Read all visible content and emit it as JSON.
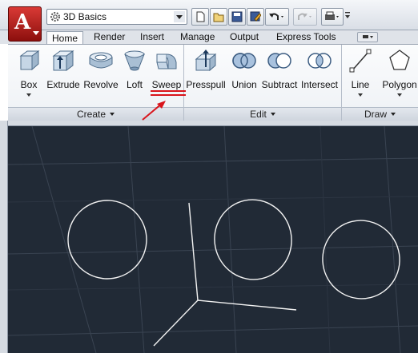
{
  "app": {
    "logo_letter": "A",
    "workspace": {
      "value": "3D Basics"
    }
  },
  "tabs": [
    {
      "label": "Home",
      "active": true
    },
    {
      "label": "Render"
    },
    {
      "label": "Insert"
    },
    {
      "label": "Manage"
    },
    {
      "label": "Output"
    },
    {
      "label": "Express Tools"
    }
  ],
  "ribbon": {
    "create": {
      "title": "Create",
      "tools": [
        {
          "label": "Box",
          "icon": "box-icon",
          "has_dropdown": true
        },
        {
          "label": "Extrude",
          "icon": "extrude-icon"
        },
        {
          "label": "Revolve",
          "icon": "revolve-icon"
        },
        {
          "label": "Loft",
          "icon": "loft-icon"
        },
        {
          "label": "Sweep",
          "icon": "sweep-icon"
        }
      ]
    },
    "edit": {
      "title": "Edit",
      "tools": [
        {
          "label": "Presspull",
          "icon": "presspull-icon"
        },
        {
          "label": "Union",
          "icon": "union-icon"
        },
        {
          "label": "Subtract",
          "icon": "subtract-icon"
        },
        {
          "label": "Intersect",
          "icon": "intersect-icon"
        }
      ]
    },
    "draw": {
      "title": "Draw",
      "tools": [
        {
          "label": "Line",
          "icon": "line-icon",
          "has_dropdown": true
        },
        {
          "label": "Polygon",
          "icon": "polygon-icon",
          "has_dropdown": true
        }
      ]
    }
  },
  "colors": {
    "canvas_bg": "#212a36",
    "annotation": "#d9141b",
    "app_button": "#c0201c"
  }
}
